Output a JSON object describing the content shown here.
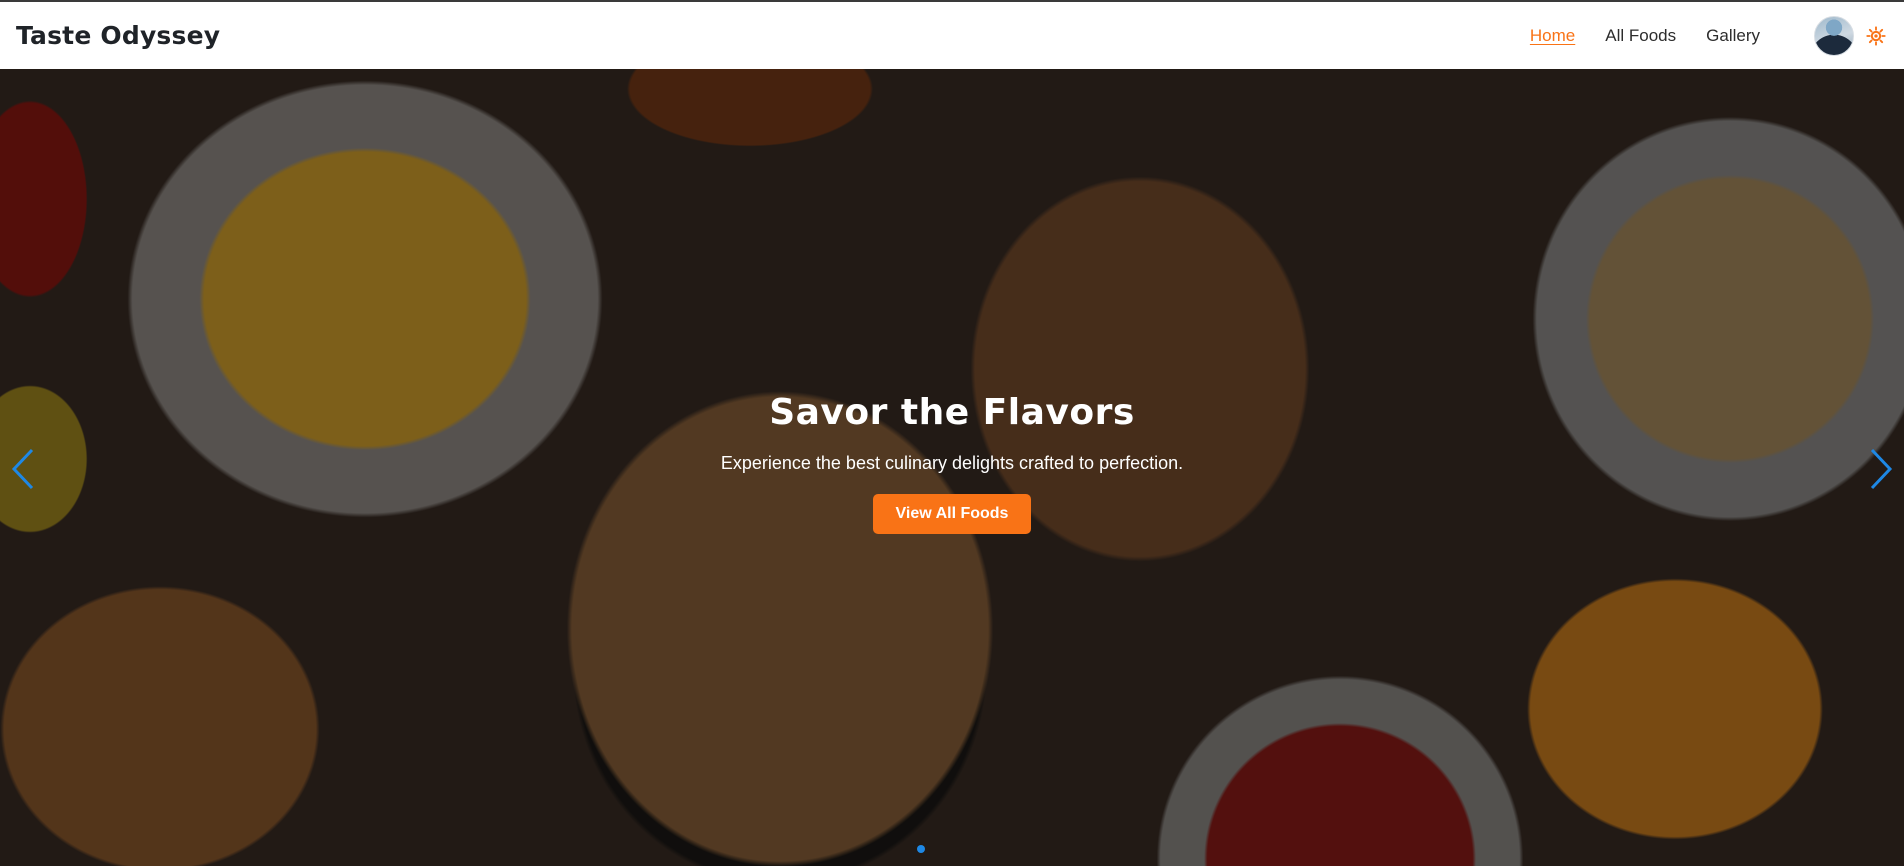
{
  "navbar": {
    "brand": "Taste Odyssey",
    "links": [
      {
        "label": "Home",
        "active": true
      },
      {
        "label": "All Foods",
        "active": false
      },
      {
        "label": "Gallery",
        "active": false
      }
    ]
  },
  "hero": {
    "title": "Savor the Flavors",
    "subtitle": "Experience the best culinary delights crafted to perfection.",
    "cta_label": "View All Foods",
    "prev_icon": "chevron-left-icon",
    "next_icon": "chevron-right-icon",
    "active_slide": 1
  },
  "colors": {
    "accent": "#f97316",
    "navigation": "#1e88e5"
  }
}
